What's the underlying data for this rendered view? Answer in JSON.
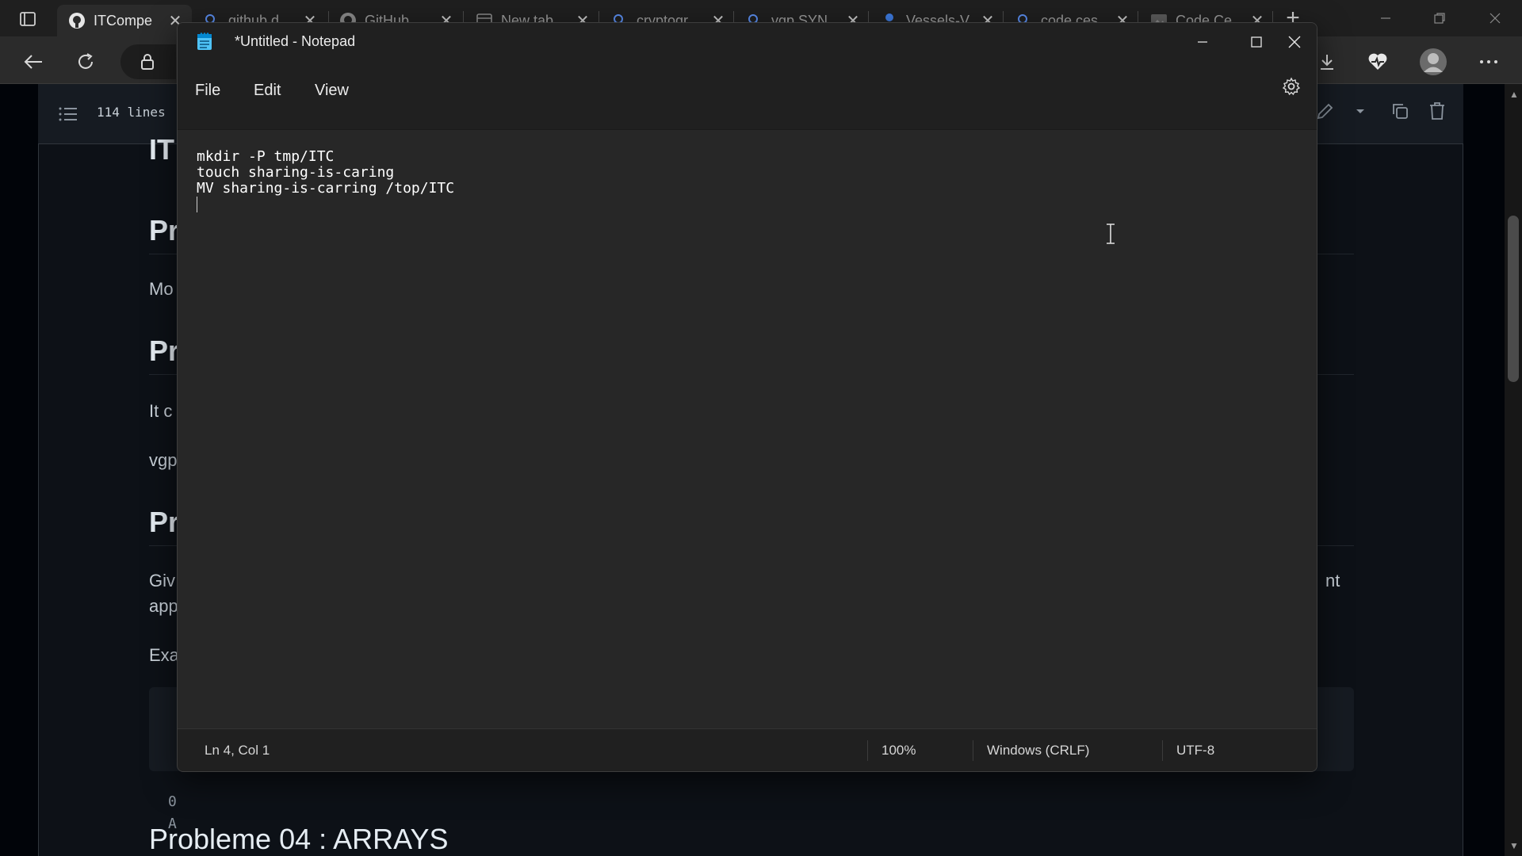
{
  "browser": {
    "tabs": [
      {
        "title": "ITCompe",
        "icon": "github-icon",
        "active": true
      },
      {
        "title": "github.d",
        "icon": "search-icon",
        "active": false
      },
      {
        "title": "GitHub",
        "icon": "github-icon",
        "active": false
      },
      {
        "title": "New tab",
        "icon": "new-tab-icon",
        "active": false
      },
      {
        "title": "cryptogr",
        "icon": "search-icon",
        "active": false
      },
      {
        "title": "vgp SYN",
        "icon": "search-icon",
        "active": false
      },
      {
        "title": "Vessels-V",
        "icon": "vessel-icon",
        "active": false
      },
      {
        "title": "code ces",
        "icon": "search-icon",
        "active": false
      },
      {
        "title": "Code Ce",
        "icon": "image-icon",
        "active": false
      }
    ],
    "tab_close_glyph": "✕",
    "new_tab_glyph": "+"
  },
  "github": {
    "lines_label": "114 lines",
    "headings": [
      "IT",
      "Pr",
      "Pr",
      "Pr"
    ],
    "paragraphs": [
      "Mo",
      "It c",
      "vgp",
      "Giv",
      "app",
      "Exa",
      "nt"
    ],
    "code_lines": [
      "0",
      "A"
    ],
    "heading_bottom": "Probleme 04 : ARRAYS"
  },
  "notepad": {
    "title": "*Untitled - Notepad",
    "menu": {
      "file": "File",
      "edit": "Edit",
      "view": "View"
    },
    "lines": [
      "mkdir -P tmp/ITC",
      "touch sharing-is-caring",
      "MV sharing-is-carring /top/ITC",
      ""
    ],
    "status": {
      "position": "Ln 4, Col 1",
      "zoom": "100%",
      "line_ending": "Windows (CRLF)",
      "encoding": "UTF-8"
    }
  }
}
